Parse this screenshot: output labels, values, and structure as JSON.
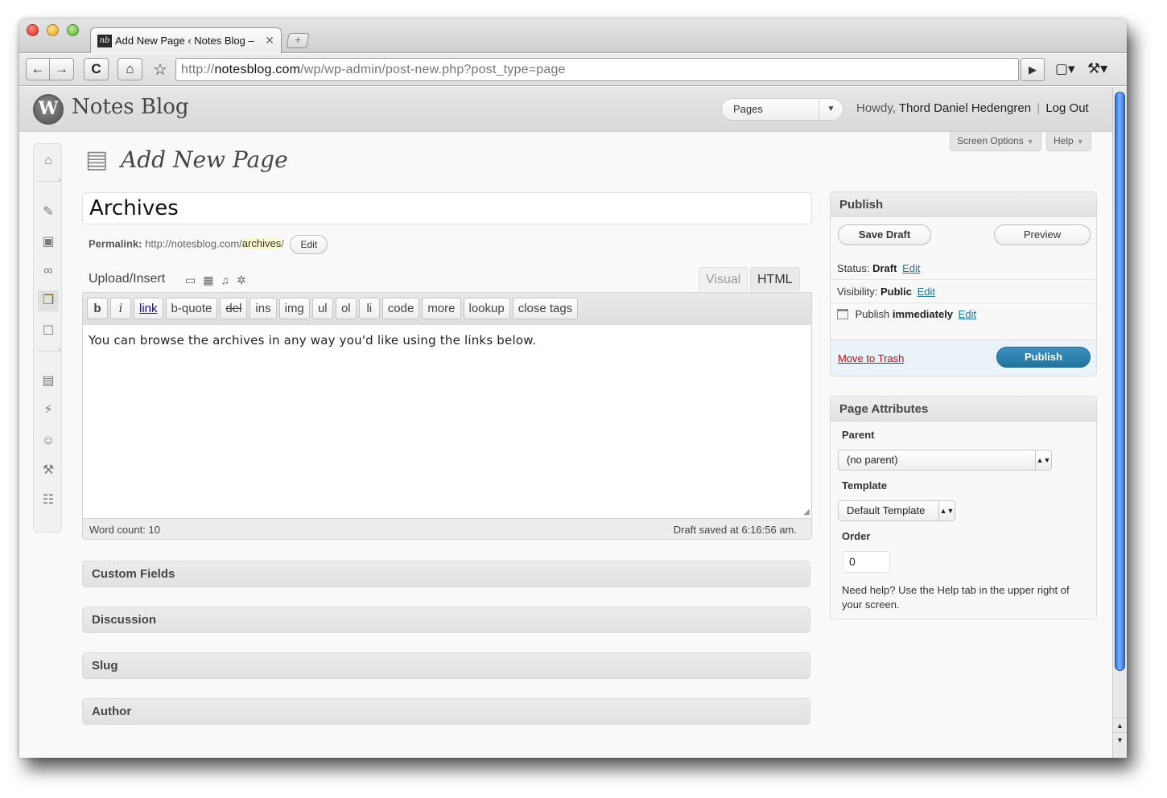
{
  "browser": {
    "tab_title": "Add New Page ‹ Notes Blog –",
    "favicon_text": "nb",
    "url_prefix": "http://",
    "url_domain": "notesblog.com",
    "url_path": "/wp/wp-admin/post-new.php?post_type=page",
    "new_tab_icon": "+",
    "back_icon": "←",
    "forward_icon": "→",
    "reload_icon": "C",
    "home_icon": "⌂",
    "star_icon": "☆",
    "go_icon": "▶",
    "page_menu_icon": "▢▾",
    "wrench_icon": "🔧▾"
  },
  "header": {
    "logo_letter": "W",
    "site_title": "Notes Blog",
    "favorite_actions": "Pages",
    "howdy": "Howdy,",
    "user_name": "Thord Daniel Hedengren",
    "separator": "|",
    "logout": "Log Out"
  },
  "tabs": {
    "screen_options": "Screen Options",
    "help": "Help"
  },
  "page": {
    "title": "Add New Page",
    "post_title": "Archives",
    "permalink_label": "Permalink:",
    "permalink_base": "http://notesblog.com/",
    "permalink_slug": "archives",
    "permalink_trailing": "/",
    "permalink_edit": "Edit"
  },
  "editor": {
    "upload_insert": "Upload/Insert",
    "tab_visual": "Visual",
    "tab_html": "HTML",
    "quicktags": [
      "b",
      "i",
      "link",
      "b-quote",
      "del",
      "ins",
      "img",
      "ul",
      "ol",
      "li",
      "code",
      "more",
      "lookup",
      "close tags"
    ],
    "content": "You can browse the archives in any way you'd like using the links below.",
    "word_count": "Word count: 10",
    "draft_saved": "Draft saved at 6:16:56 am."
  },
  "metaboxes": [
    "Custom Fields",
    "Discussion",
    "Slug",
    "Author"
  ],
  "publish": {
    "heading": "Publish",
    "save_draft": "Save Draft",
    "preview": "Preview",
    "status_label": "Status:",
    "status_value": "Draft",
    "visibility_label": "Visibility:",
    "visibility_value": "Public",
    "publish_label": "Publish",
    "publish_value": "immediately",
    "edit": "Edit",
    "move_to_trash": "Move to Trash",
    "publish_button": "Publish"
  },
  "page_attributes": {
    "heading": "Page Attributes",
    "parent_label": "Parent",
    "parent_value": "(no parent)",
    "template_label": "Template",
    "template_value": "Default Template",
    "order_label": "Order",
    "order_value": "0",
    "help_text": "Need help? Use the Help tab in the upper right of your screen."
  },
  "colors": {
    "accent_blue": "#21759b",
    "trash_red": "#bc0b0b",
    "slug_highlight": "#fffbcc"
  }
}
